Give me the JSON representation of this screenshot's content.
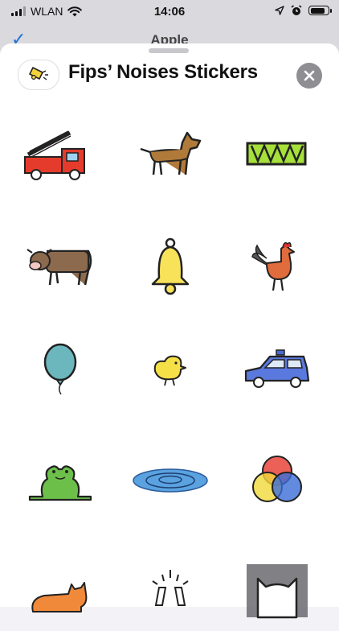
{
  "status_bar": {
    "carrier": "WLAN",
    "time": "14:06",
    "battery_level": 0.85
  },
  "background_nav": {
    "title": "Apple"
  },
  "sheet": {
    "title": "Fips’ Noises Stickers",
    "app_icon": "bell-icon",
    "close_icon": "close-icon"
  },
  "stickers": [
    "fire-truck-sticker",
    "dog-sticker",
    "drum-sticker",
    "cow-sticker",
    "bell-sticker",
    "rooster-sticker",
    "balloon-sticker",
    "chick-sticker",
    "police-car-sticker",
    "frog-sticker",
    "water-ripple-sticker",
    "color-circles-sticker",
    "cat-sticker",
    "glasses-toast-sticker",
    "cat-face-sticker"
  ]
}
